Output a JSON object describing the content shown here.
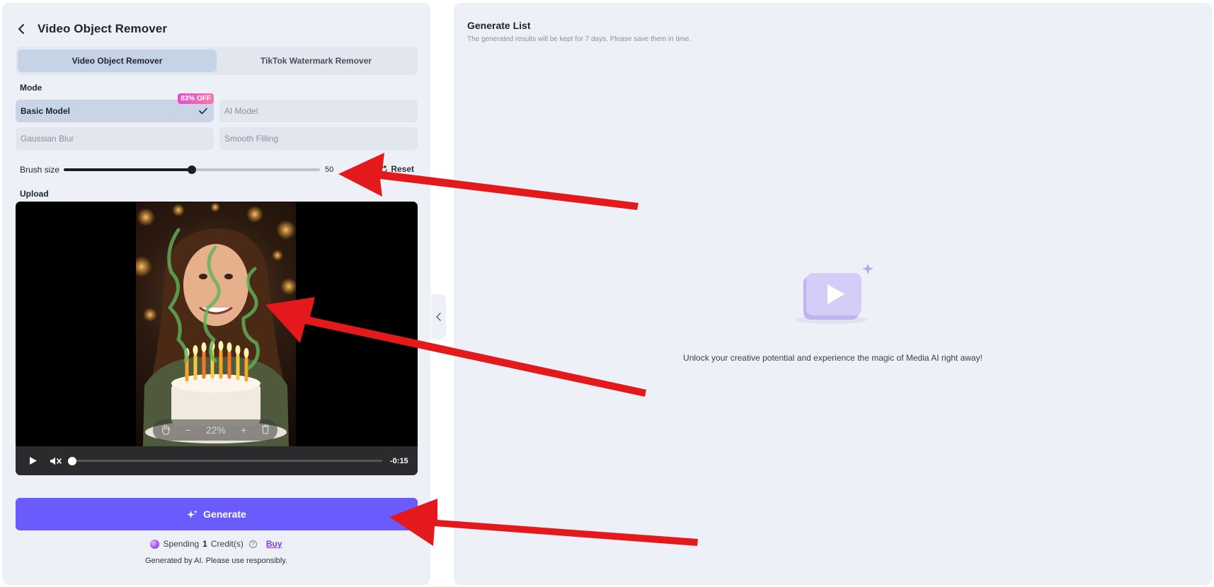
{
  "left_panel": {
    "title": "Video Object Remover",
    "tabs": [
      {
        "label": "Video Object Remover",
        "active": true
      },
      {
        "label": "TikTok Watermark Remover",
        "active": false
      }
    ],
    "mode_label": "Mode",
    "modes": [
      {
        "label": "Basic Model",
        "selected": true,
        "badge": "83% OFF"
      },
      {
        "label": "AI Model",
        "selected": false
      },
      {
        "label": "Gaussian Blur",
        "selected": false
      },
      {
        "label": "Smooth Filling",
        "selected": false
      }
    ],
    "brush": {
      "label": "Brush size",
      "value": "50",
      "fraction": 0.5,
      "reset_label": "Reset"
    },
    "upload_label": "Upload",
    "video": {
      "zoom": "22%",
      "time_remaining": "-0:15",
      "progress": 0
    },
    "generate_label": "Generate",
    "spending": {
      "prefix": "Spending",
      "amount": "1",
      "suffix": "Credit(s)",
      "buy_label": "Buy"
    },
    "disclaimer": "Generated by AI. Please use responsibly."
  },
  "right_panel": {
    "title": "Generate List",
    "subtitle": "The generated results will be kept for 7 days. Please save them in time.",
    "empty_text": "Unlock your creative potential and experience the magic of Media AI right away!"
  },
  "colors": {
    "accent": "#6a5cfc",
    "panel_bg": "#edf0f6",
    "badge": "#e64bd0",
    "annotation_arrow": "#e3191c"
  }
}
